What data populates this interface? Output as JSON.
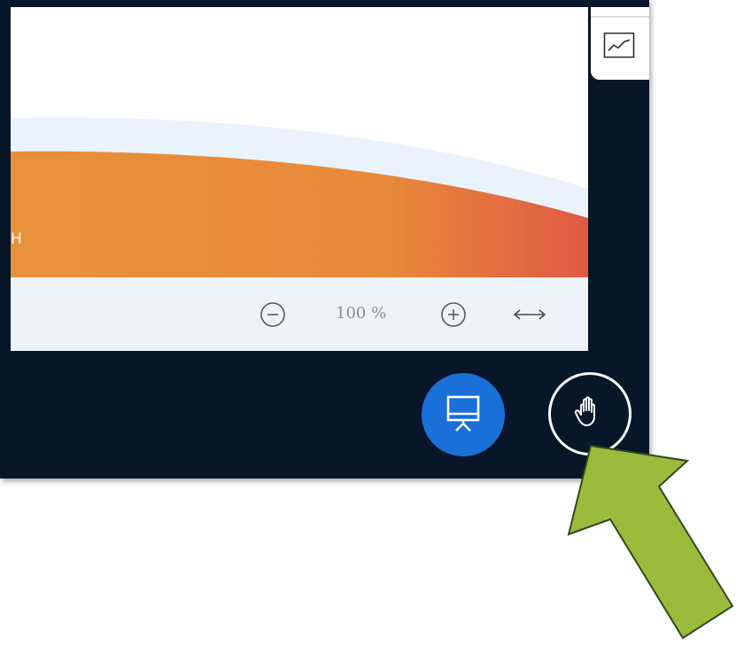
{
  "slide": {
    "partial_text": "H",
    "colors": {
      "band_light": "#eaf3fb",
      "band_orange_start": "#e8913a",
      "band_orange_end": "#e05a45",
      "background": "#ffffff"
    }
  },
  "zoom_bar": {
    "zoom_out_icon": "minus-circle-icon",
    "zoom_value": "100 %",
    "zoom_in_icon": "plus-circle-icon",
    "fit_width_icon": "horizontal-arrows-icon"
  },
  "side_panel": {
    "tab_icon": "line-chart-icon"
  },
  "controls": {
    "present_button_icon": "presentation-screen-icon",
    "present_button_color": "#1a6fd8",
    "raise_hand_icon": "raise-hand-icon"
  },
  "annotation": {
    "arrow_color": "#9bbb3c",
    "arrow_outline": "#2f4a1b"
  },
  "colors": {
    "app_background": "#071729",
    "zoom_bar_background": "#eef3f9"
  }
}
